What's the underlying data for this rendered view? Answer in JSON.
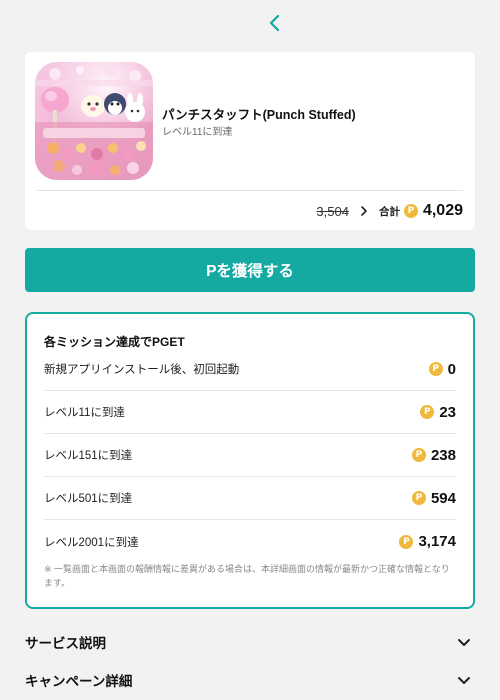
{
  "header": {
    "back_icon": "chevron-left-icon",
    "accent": "#14aaa1"
  },
  "app": {
    "title": "パンチスタッフト(Punch Stuffed)",
    "subtitle": "レベル11に到達",
    "image": "cute-plush-bakery-app-icon"
  },
  "price": {
    "original": "3,504",
    "total_label": "合計",
    "coin_symbol": "P",
    "total": "4,029"
  },
  "cta": {
    "label": "Pを獲得する"
  },
  "missions": {
    "title": "各ミッション達成でPGET",
    "items": [
      {
        "label": "新規アプリインストール後、初回起動",
        "value": "0"
      },
      {
        "label": "レベル11に到達",
        "value": "23"
      },
      {
        "label": "レベル151に到達",
        "value": "238"
      },
      {
        "label": "レベル501に到達",
        "value": "594"
      },
      {
        "label": "レベル2001に到達",
        "value": "3,174"
      }
    ],
    "note": "※ 一覧画面と本画面の報酬情報に差異がある場合は、本詳細画面の情報が最新かつ正確な情報となります。"
  },
  "sections": [
    {
      "label": "サービス説明"
    },
    {
      "label": "キャンペーン詳細"
    }
  ]
}
